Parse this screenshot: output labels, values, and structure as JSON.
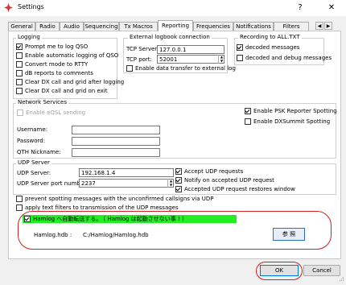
{
  "window": {
    "title": "Settings",
    "help": "?",
    "close": "✕"
  },
  "tabs": [
    "General",
    "Radio",
    "Audio",
    "Sequencing",
    "Tx Macros",
    "Reporting",
    "Frequencies",
    "Notifications",
    "Filters"
  ],
  "active_tab": "Reporting",
  "logging": {
    "title": "Logging",
    "items": [
      {
        "label": "Prompt me to log QSO",
        "checked": true
      },
      {
        "label": "Enable automatic logging of QSO",
        "checked": false
      },
      {
        "label": "Convert mode to RTTY",
        "checked": false
      },
      {
        "label": "dB reports to comments",
        "checked": false
      },
      {
        "label": "Clear DX call and grid after logging",
        "checked": false
      },
      {
        "label": "Clear DX call and grid on exit",
        "checked": false
      }
    ]
  },
  "external_logbook": {
    "title": "External logbook connection",
    "tcp_server_label": "TCP Server:",
    "tcp_server_value": "127.0.0.1",
    "tcp_port_label": "TCP port:",
    "tcp_port_value": "52001",
    "enable_transfer_label": "Enable data transfer to external log",
    "enable_transfer_checked": false
  },
  "recording": {
    "title": "Recording to ALL.TXT",
    "items": [
      {
        "label": "decoded messages",
        "checked": true
      },
      {
        "label": "decoded and debug messages",
        "checked": false
      }
    ]
  },
  "network": {
    "title": "Network Services",
    "eqsl_label": "Enable eQSL sending",
    "username_label": "Username:",
    "password_label": "Password:",
    "qth_label": "QTH Nickname:",
    "psk_label": "Enable PSK Reporter Spotting",
    "psk_checked": true,
    "dxsummit_label": "Enable DXSummit Spotting",
    "dxsummit_checked": false
  },
  "udp": {
    "title": "UDP Server",
    "server_label": "UDP Server:",
    "server_value": "192.168.1.4",
    "port_label": "UDP Server port number:",
    "port_value": "2237",
    "accept_label": "Accept UDP requests",
    "accept_checked": true,
    "notify_label": "Notify on accepted UDP request",
    "notify_checked": true,
    "restore_label": "Accepted UDP request restores window",
    "restore_checked": true
  },
  "options": {
    "prevent_label": "prevent spotting messages with the unconfirmed callsigns via UDP",
    "prevent_checked": false,
    "filters_label": "apply text filters to transmission of the UDP messages",
    "filters_checked": false
  },
  "hamlog": {
    "auto_label": "Hamlog へ自動転送する。 ( Hamlog は起動させない事 ! )",
    "auto_checked": true,
    "path_label": "Hamlog.hdb :",
    "path_value": "C:/Hamlog/Hamlog.hdb",
    "browse_label": "参 照"
  },
  "buttons": {
    "ok": "OK",
    "cancel": "Cancel"
  },
  "colors": {
    "highlight": "#22ee22",
    "annotation": "#d02020"
  }
}
